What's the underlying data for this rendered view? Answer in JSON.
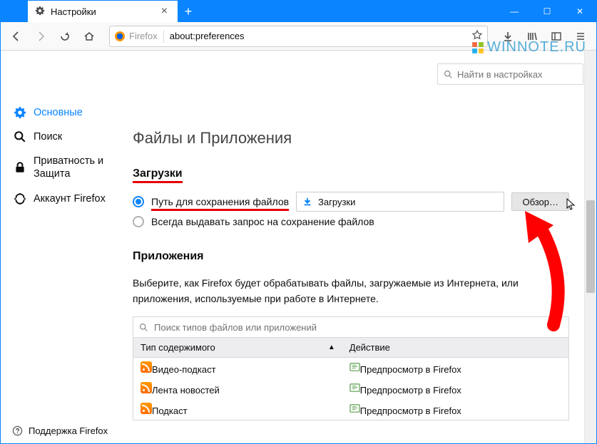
{
  "window": {
    "tab_title": "Настройки",
    "min": "—",
    "max": "☐",
    "close": "✕",
    "plus": "+"
  },
  "toolbar": {
    "identity": "Firefox",
    "url": "about:preferences"
  },
  "watermark": "WINNOTE.RU",
  "sidebar": {
    "items": [
      {
        "label": "Основные"
      },
      {
        "label": "Поиск"
      },
      {
        "label": "Приватность и Защита"
      },
      {
        "label": "Аккаунт Firefox"
      }
    ],
    "support": "Поддержка Firefox"
  },
  "search": {
    "placeholder": "Найти в настройках"
  },
  "main": {
    "heading": "Файлы и Приложения",
    "downloads": {
      "title": "Загрузки",
      "save_to_label": "Путь для сохранения файлов",
      "folder": "Загрузки",
      "browse": "Обзор…",
      "always_ask": "Всегда выдавать запрос на сохранение файлов"
    },
    "apps": {
      "title": "Приложения",
      "desc": "Выберите, как Firefox будет обрабатывать файлы, загружаемые из Интернета, или приложения, используемые при работе в Интернете.",
      "search_placeholder": "Поиск типов файлов или приложений",
      "col_type": "Тип содержимого",
      "col_action": "Действие",
      "rows": [
        {
          "type": "Видео-подкаст",
          "action": "Предпросмотр в Firefox"
        },
        {
          "type": "Лента новостей",
          "action": "Предпросмотр в Firefox"
        },
        {
          "type": "Подкаст",
          "action": "Предпросмотр в Firefox"
        }
      ]
    }
  }
}
